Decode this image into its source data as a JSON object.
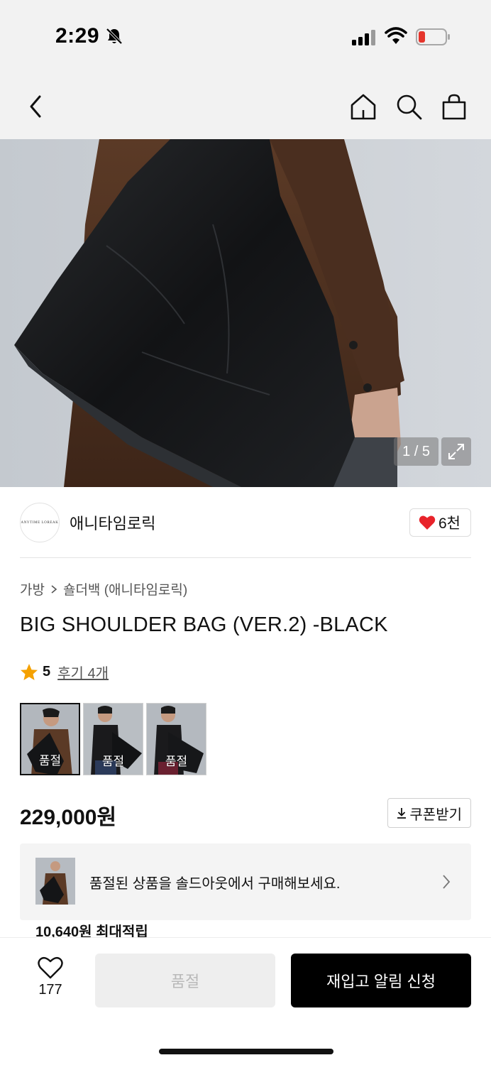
{
  "status_bar": {
    "time": "2:29",
    "icons": [
      "bell-off-icon",
      "cellular-signal-icon",
      "wifi-icon",
      "battery-low-icon"
    ]
  },
  "nav": {
    "icons": [
      "back-icon",
      "home-icon",
      "search-icon",
      "shopping-bag-icon"
    ]
  },
  "hero": {
    "page_indicator": "1 / 5"
  },
  "brand": {
    "logo_text": "ANYTIME LOREAK",
    "name": "애니타임로릭",
    "like_count": "6천"
  },
  "breadcrumb": {
    "category": "가방",
    "subcategory": "숄더백 (애니타임로릭)"
  },
  "product": {
    "title": "BIG SHOULDER BAG (VER.2) -BLACK",
    "rating": "5",
    "review_label": "후기 4개",
    "price": "229,000원",
    "coupon_label": "쿠폰받기"
  },
  "thumbnails": [
    {
      "label": "품절",
      "selected": true
    },
    {
      "label": "품절",
      "selected": false
    },
    {
      "label": "품절",
      "selected": false
    }
  ],
  "soldout_banner": {
    "text": "품절된 상품을 솔드아웃에서 구매해보세요."
  },
  "points": {
    "amount": "10,640원",
    "label": "최대적립"
  },
  "bottom_bar": {
    "wish_count": "177",
    "soldout_button": "품절",
    "restock_button": "재입고 알림 신청"
  },
  "colors": {
    "accent_heart": "#e8232a",
    "star": "#f5a100",
    "primary_button": "#000000"
  }
}
